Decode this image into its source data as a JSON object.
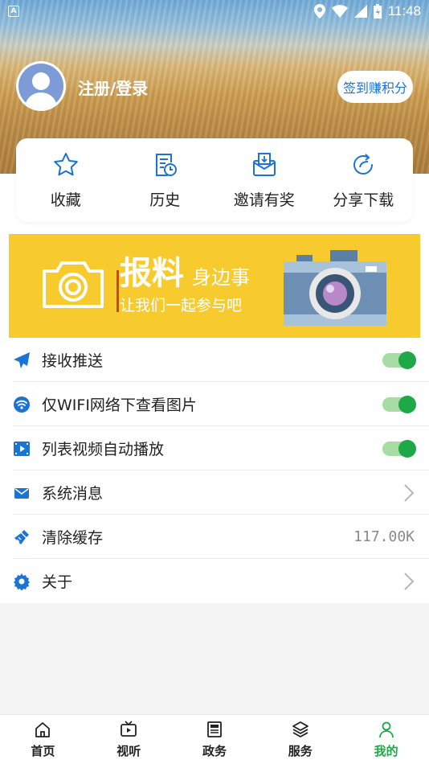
{
  "status_bar": {
    "badge": "A",
    "time": "11:48"
  },
  "header": {
    "login_text": "注册/登录",
    "signin_button": "签到赚积分"
  },
  "quick_actions": [
    {
      "label": "收藏",
      "icon": "star-icon"
    },
    {
      "label": "历史",
      "icon": "history-icon"
    },
    {
      "label": "邀请有奖",
      "icon": "invite-gift-icon"
    },
    {
      "label": "分享下载",
      "icon": "share-refresh-icon"
    }
  ],
  "banner": {
    "big": "报料",
    "side": "身边事",
    "sub": "让我们一起参与吧"
  },
  "settings": [
    {
      "label": "接收推送",
      "icon": "paper-plane-icon",
      "type": "toggle",
      "on": true
    },
    {
      "label": "仅WIFI网络下查看图片",
      "icon": "wifi-icon",
      "type": "toggle",
      "on": true
    },
    {
      "label": "列表视频自动播放",
      "icon": "film-icon",
      "type": "toggle",
      "on": true
    },
    {
      "label": "系统消息",
      "icon": "envelope-icon",
      "type": "arrow"
    },
    {
      "label": "清除缓存",
      "icon": "broom-icon",
      "type": "value",
      "value": "117.00K"
    },
    {
      "label": "关于",
      "icon": "gear-icon",
      "type": "arrow"
    }
  ],
  "bottom_nav": [
    {
      "label": "首页",
      "icon": "home-icon",
      "active": false
    },
    {
      "label": "视听",
      "icon": "tv-play-icon",
      "active": false
    },
    {
      "label": "政务",
      "icon": "newspaper-icon",
      "active": false
    },
    {
      "label": "服务",
      "icon": "layers-icon",
      "active": false
    },
    {
      "label": "我的",
      "icon": "user-icon",
      "active": true
    }
  ],
  "colors": {
    "accent_blue": "#1b73d4",
    "active_green": "#1fa847",
    "banner_yellow": "#f7cb2e"
  }
}
